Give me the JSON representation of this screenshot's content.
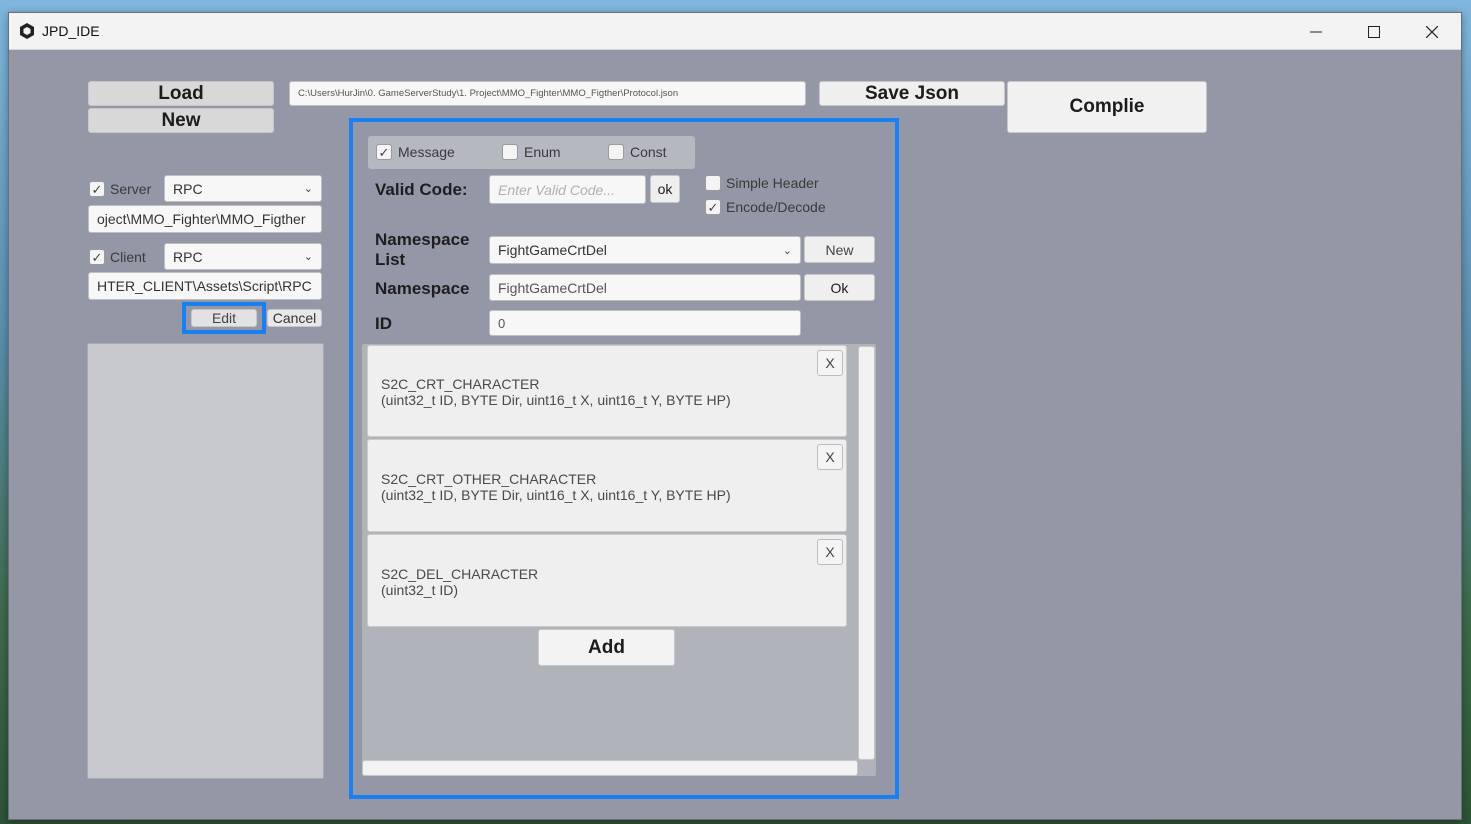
{
  "window": {
    "title": "JPD_IDE"
  },
  "left": {
    "load_label": "Load",
    "new_label": "New",
    "server": {
      "label": "Server",
      "checked": true,
      "type": "RPC",
      "path": "oject\\MMO_Fighter\\MMO_Figther"
    },
    "client": {
      "label": "Client",
      "checked": true,
      "type": "RPC",
      "path": "HTER_CLIENT\\Assets\\Script\\RPC"
    },
    "edit_label": "Edit",
    "cancel_label": "Cancel"
  },
  "top": {
    "path": "C:\\Users\\HurJin\\0. GameServerStudy\\1. Project\\MMO_Fighter\\MMO_Figther\\Protocol.json",
    "save_json_label": "Save Json",
    "compile_label": "Complie"
  },
  "editor": {
    "tabs": [
      {
        "label": "Message",
        "checked": true
      },
      {
        "label": "Enum",
        "checked": false
      },
      {
        "label": "Const",
        "checked": false
      }
    ],
    "valid_code_label": "Valid Code:",
    "valid_code_placeholder": "Enter Valid Code...",
    "valid_ok_label": "ok",
    "simple_header": {
      "label": "Simple Header",
      "checked": false
    },
    "encode_decode": {
      "label": "Encode/Decode",
      "checked": true
    },
    "namespace_list_label": "Namespace\nList",
    "namespace_list_value": "FightGameCrtDel",
    "namespace_new_label": "New",
    "namespace_label": "Namespace",
    "namespace_value": "FightGameCrtDel",
    "namespace_ok_label": "Ok",
    "id_label": "ID",
    "id_value": "0",
    "messages": [
      {
        "name": "S2C_CRT_CHARACTER",
        "params": "(uint32_t ID, BYTE Dir, uint16_t X, uint16_t Y, BYTE HP)",
        "close": "X"
      },
      {
        "name": "S2C_CRT_OTHER_CHARACTER",
        "params": "(uint32_t ID, BYTE Dir, uint16_t X, uint16_t Y, BYTE HP)",
        "close": "X"
      },
      {
        "name": "S2C_DEL_CHARACTER",
        "params": "(uint32_t ID)",
        "close": "X"
      }
    ],
    "add_label": "Add"
  },
  "colors": {
    "accent": "#1a7ff0",
    "window_bg": "#9498a6"
  }
}
